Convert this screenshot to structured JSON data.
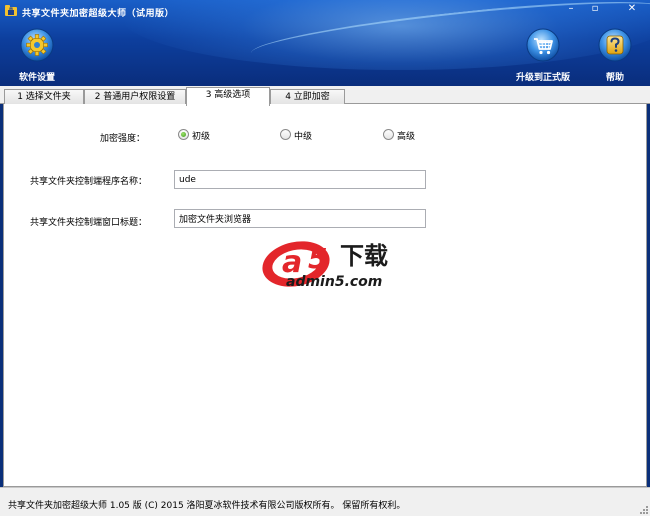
{
  "window": {
    "title": "共享文件夹加密超级大师（试用版）",
    "minimize_glyph": "–",
    "restore_glyph": "▫",
    "close_glyph": "✕"
  },
  "toolbar": {
    "settings_label": "软件设置",
    "settings_icon": "gear-icon",
    "upgrade_label": "升级到正式版",
    "upgrade_icon": "cart-icon",
    "help_label": "帮助",
    "help_icon": "question-icon"
  },
  "tabs": [
    {
      "label": "1 选择文件夹",
      "active": false
    },
    {
      "label": "2 普通用户权限设置",
      "active": false
    },
    {
      "label": "3 高级选项",
      "active": true
    },
    {
      "label": "4 立即加密",
      "active": false
    }
  ],
  "advanced": {
    "strength_label": "加密强度：",
    "strength_options": [
      {
        "label": "初级",
        "selected": true
      },
      {
        "label": "中级",
        "selected": false
      },
      {
        "label": "高级",
        "selected": false
      }
    ],
    "program_name_label": "共享文件夹控制端程序名称：",
    "program_name_value": "ude",
    "window_title_label": "共享文件夹控制端窗口标题：",
    "window_title_value": "加密文件夹浏览器"
  },
  "watermark": {
    "brand_a": "a",
    "brand_5": "5",
    "brand_cn": "下载",
    "brand_url": "admin5.com"
  },
  "statusbar": {
    "text": "共享文件夹加密超级大师 1.05 版  (C)  2015 洛阳夏冰软件技术有限公司版权所有。 保留所有权利。"
  },
  "colors": {
    "header_top": "#1a5fc8",
    "header_bottom": "#0a2d7c",
    "radio_selected": "#3e9a1f",
    "watermark_red": "#e3262b"
  }
}
